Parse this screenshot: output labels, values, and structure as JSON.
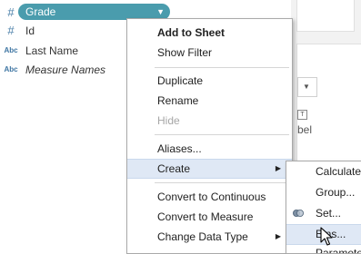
{
  "data_pane": {
    "selected_field": {
      "type_icon": "#",
      "label": "Grade"
    },
    "fields": [
      {
        "type_icon": "#",
        "label": "Id",
        "italic": false
      },
      {
        "type_icon": "Abc",
        "label": "Last Name",
        "italic": false
      },
      {
        "type_icon": "Abc",
        "label": "Measure Names",
        "italic": true
      }
    ]
  },
  "right_panel": {
    "label_text": "bel"
  },
  "context_menu": {
    "items": [
      {
        "label": "Add to Sheet",
        "bold": true
      },
      {
        "label": "Show Filter"
      },
      {
        "label": "Duplicate"
      },
      {
        "label": "Rename"
      },
      {
        "label": "Hide",
        "disabled": true
      },
      {
        "label": "Aliases..."
      },
      {
        "label": "Create",
        "has_submenu": true,
        "highlighted": true
      },
      {
        "label": "Convert to Continuous"
      },
      {
        "label": "Convert to Measure"
      },
      {
        "label": "Change Data Type",
        "has_submenu": true
      }
    ]
  },
  "create_submenu": {
    "items": [
      {
        "label": "Calculated Field..."
      },
      {
        "label": "Group..."
      },
      {
        "label": "Set...",
        "icon": "set-icon"
      },
      {
        "label": "Bins...",
        "highlighted": true
      },
      {
        "label": "Parameter..."
      }
    ]
  },
  "colors": {
    "pill": "#4a9cad",
    "highlight": "#dfe8f5",
    "field_icon": "#4a7fa8",
    "disabled_text": "#a6a6a6"
  }
}
